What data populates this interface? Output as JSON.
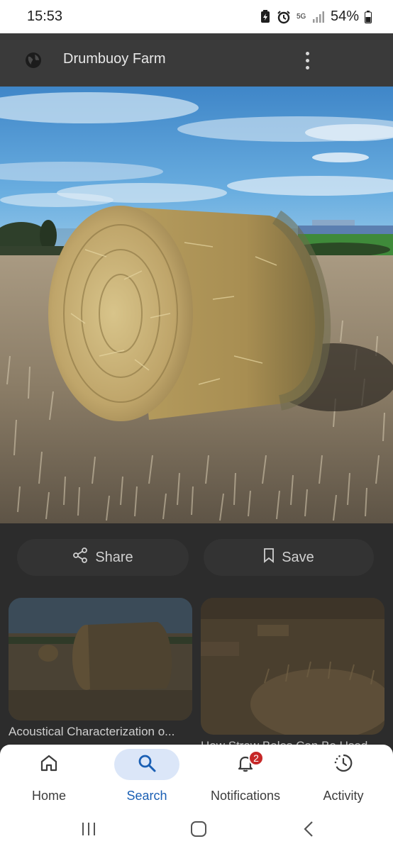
{
  "status_bar": {
    "time": "15:53",
    "network": "5G",
    "battery": "54%"
  },
  "top_bar": {
    "title": "Drumbuoy Farm",
    "icons": [
      "globe-icon",
      "more-vert-icon"
    ]
  },
  "actions": {
    "share_label": "Share",
    "save_label": "Save"
  },
  "related": [
    {
      "title": "Acoustical Characterization o..."
    },
    {
      "title": "How Straw Bales Can Be Used..."
    }
  ],
  "bottom_nav": {
    "items": [
      {
        "label": "Home",
        "icon": "home-icon",
        "active": false
      },
      {
        "label": "Search",
        "icon": "search-icon",
        "active": true
      },
      {
        "label": "Notifications",
        "icon": "bell-icon",
        "active": false,
        "badge": "2"
      },
      {
        "label": "Activity",
        "icon": "activity-icon",
        "active": false
      }
    ]
  },
  "colors": {
    "accent": "#1a5fb4",
    "active_pill": "#dbe6f8",
    "badge": "#c62828",
    "top_bar": "#3a3a3a",
    "panel": "#2c2c2c"
  }
}
